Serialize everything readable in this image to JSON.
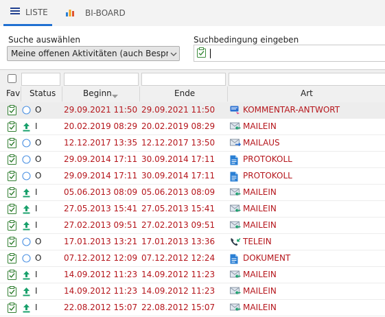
{
  "tabs": [
    {
      "label": "LISTE",
      "icon": "list-icon",
      "active": true
    },
    {
      "label": "BI-BOARD",
      "icon": "bar-chart-icon",
      "active": false
    }
  ],
  "search": {
    "select_label": "Suche auswählen",
    "select_value": "Meine offenen Aktivitäten (auch Besprec...",
    "condition_label": "Suchbedingung eingeben",
    "condition_value": ""
  },
  "columns": {
    "fav": "Fav",
    "status": "Status",
    "begin": "Beginn",
    "end": "Ende",
    "art": "Art"
  },
  "colors": {
    "date": "#b5151b",
    "accent": "#1f6fd1",
    "status_circle": "#4a90e2",
    "arrow_green": "#18a06b"
  },
  "rows": [
    {
      "status": "O",
      "begin": "29.09.2021 11:50",
      "end": "29.09.2021 11:50",
      "art": "KOMMENTAR-ANTWORT",
      "art_icon": "comment-reply-icon",
      "status_icon": "open-circle-icon",
      "selected": true
    },
    {
      "status": "I",
      "begin": "20.02.2019 08:29",
      "end": "20.02.2019 08:29",
      "art": "MAILEIN",
      "art_icon": "mail-in-icon",
      "status_icon": "upload-arrow-icon"
    },
    {
      "status": "O",
      "begin": "12.12.2017 13:35",
      "end": "12.12.2017 13:50",
      "art": "MAILAUS",
      "art_icon": "mail-out-icon",
      "status_icon": "open-circle-icon"
    },
    {
      "status": "O",
      "begin": "29.09.2014 17:11",
      "end": "30.09.2014 17:11",
      "art": "PROTOKOLL",
      "art_icon": "document-icon",
      "status_icon": "open-circle-icon"
    },
    {
      "status": "O",
      "begin": "29.09.2014 17:11",
      "end": "30.09.2014 17:11",
      "art": "PROTOKOLL",
      "art_icon": "document-icon",
      "status_icon": "open-circle-icon"
    },
    {
      "status": "I",
      "begin": "05.06.2013 08:09",
      "end": "05.06.2013 08:09",
      "art": "MAILEIN",
      "art_icon": "mail-in-icon",
      "status_icon": "upload-arrow-icon"
    },
    {
      "status": "I",
      "begin": "27.05.2013 15:41",
      "end": "27.05.2013 15:41",
      "art": "MAILEIN",
      "art_icon": "mail-in-icon",
      "status_icon": "upload-arrow-icon"
    },
    {
      "status": "I",
      "begin": "27.02.2013 09:51",
      "end": "27.02.2013 09:51",
      "art": "MAILEIN",
      "art_icon": "mail-in-icon",
      "status_icon": "upload-arrow-icon"
    },
    {
      "status": "O",
      "begin": "17.01.2013 13:21",
      "end": "17.01.2013 13:36",
      "art": "TELEIN",
      "art_icon": "phone-in-icon",
      "status_icon": "open-circle-icon"
    },
    {
      "status": "O",
      "begin": "07.12.2012 12:09",
      "end": "07.12.2012 12:24",
      "art": "DOKUMENT",
      "art_icon": "document-icon",
      "status_icon": "open-circle-icon"
    },
    {
      "status": "I",
      "begin": "14.09.2012 11:23",
      "end": "14.09.2012 11:23",
      "art": "MAILEIN",
      "art_icon": "mail-in-icon",
      "status_icon": "upload-arrow-icon"
    },
    {
      "status": "I",
      "begin": "14.09.2012 11:23",
      "end": "14.09.2012 11:23",
      "art": "MAILEIN",
      "art_icon": "mail-in-icon",
      "status_icon": "upload-arrow-icon"
    },
    {
      "status": "I",
      "begin": "22.08.2012 15:07",
      "end": "22.08.2012 15:07",
      "art": "MAILEIN",
      "art_icon": "mail-in-icon",
      "status_icon": "upload-arrow-icon"
    }
  ]
}
